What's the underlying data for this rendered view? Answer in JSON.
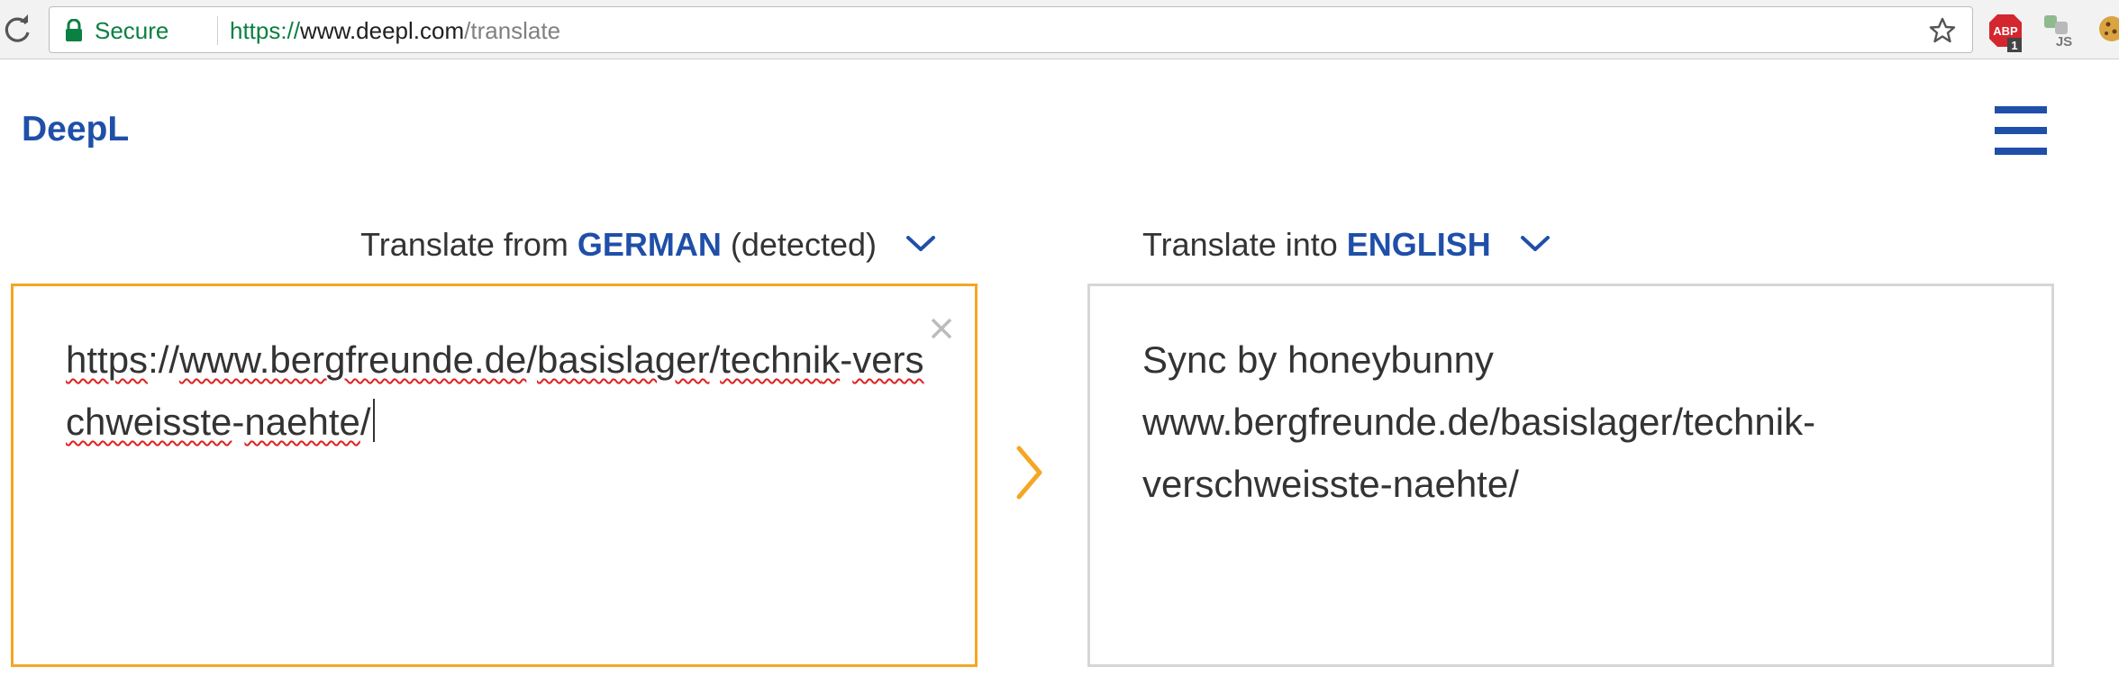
{
  "browser": {
    "secure_label": "Secure",
    "url_scheme": "https://",
    "url_host": "www.deepl.com",
    "url_path": "/translate",
    "abp_badge": "1",
    "js_ext_label": "JS"
  },
  "header": {
    "logo": "DeepL"
  },
  "source": {
    "prefix": "Translate from ",
    "language": "GERMAN",
    "suffix": " (detected)",
    "text_parts": [
      "https",
      "://",
      "www.bergfreunde.de",
      "/",
      "basislager",
      "/",
      "techni",
      "k",
      "-",
      "verschweisste",
      "-",
      "naehte",
      "/"
    ]
  },
  "target": {
    "prefix": "Translate into ",
    "language": "ENGLISH",
    "line1": "Sync by honeybunny",
    "line2": "www.bergfreunde.de/basislager/technik-",
    "line3": "verschweisste-naehte/"
  },
  "colors": {
    "brand_blue": "#1f4fa8",
    "source_border": "#f5a623",
    "target_border": "#d6d6d6",
    "secure_green": "#0b8043"
  },
  "icons": [
    "reload-icon",
    "lock-icon",
    "star-icon",
    "abp-icon",
    "js-extension-icon",
    "cookie-icon",
    "menu-icon",
    "chevron-down-icon",
    "close-icon",
    "arrow-right-icon"
  ]
}
